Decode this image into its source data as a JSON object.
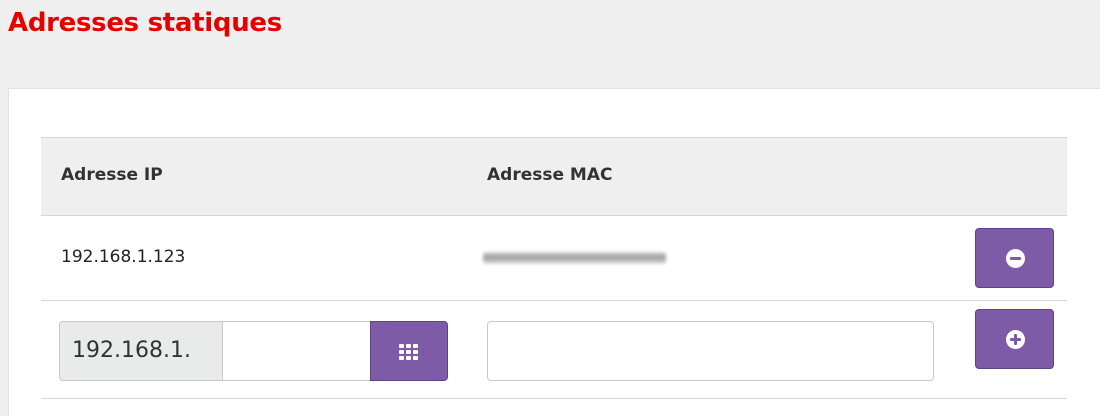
{
  "page": {
    "title": "Adresses statiques"
  },
  "table": {
    "headers": {
      "ip": "Adresse IP",
      "mac": "Adresse MAC"
    },
    "rows": [
      {
        "ip": "192.168.1.123",
        "mac": ""
      }
    ]
  },
  "new_entry": {
    "ip_prefix": "192.168.1.",
    "ip_suffix_value": "",
    "mac_value": ""
  },
  "icons": {
    "remove": "minus-circle-icon",
    "add": "plus-circle-icon",
    "grid": "grid-icon"
  },
  "colors": {
    "title": "#e60000",
    "button": "#7d5ba6"
  }
}
